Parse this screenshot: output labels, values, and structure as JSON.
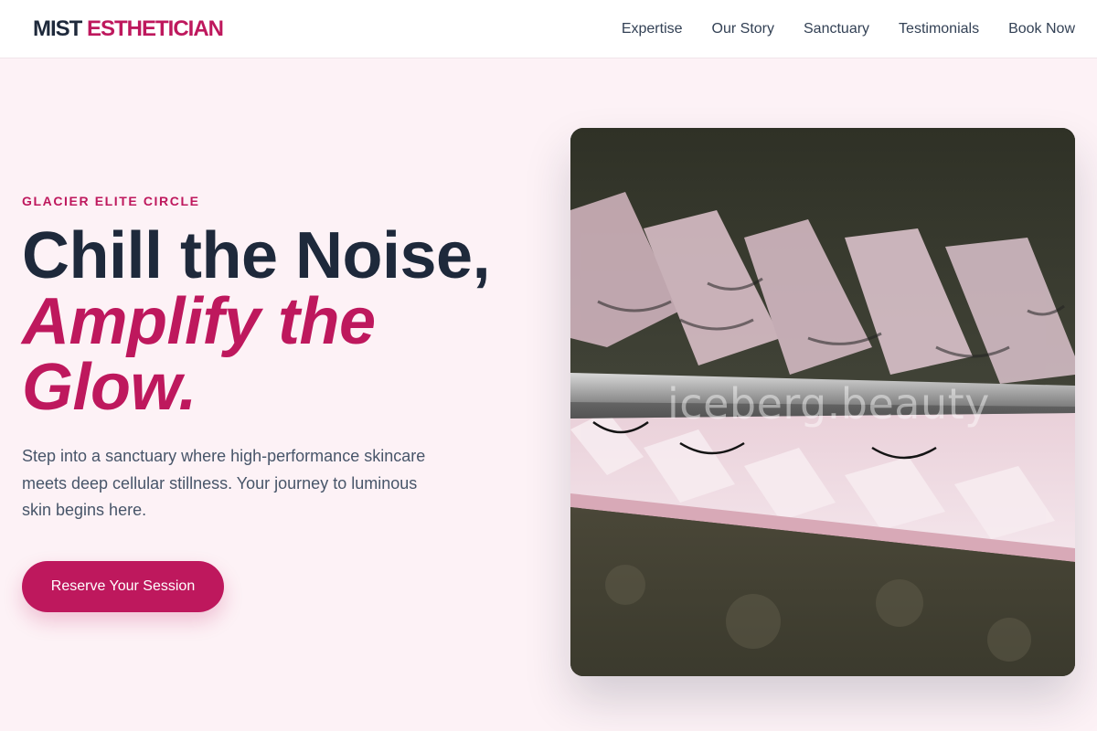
{
  "brand": {
    "name_part1": "MIST",
    "name_part2": "ESTHETICIAN"
  },
  "nav": {
    "items": [
      {
        "label": "Expertise"
      },
      {
        "label": "Our Story"
      },
      {
        "label": "Sanctuary"
      },
      {
        "label": "Testimonials"
      },
      {
        "label": "Book Now"
      }
    ]
  },
  "hero": {
    "eyebrow": "GLACIER ELITE CIRCLE",
    "headline_line1": "Chill the Noise,",
    "headline_line2": "Amplify the",
    "headline_line3": "Glow.",
    "subtext": "Step into a sanctuary where high-performance skincare meets deep cellular stillness. Your journey to luminous skin begins here.",
    "cta_label": "Reserve Your Session",
    "image_watermark": "iceberg.beauty"
  },
  "colors": {
    "accent": "#be185d",
    "heading": "#1e293b",
    "page_background": "#fdf2f6"
  },
  "icons": {
    "hero_image": "eyelash-tray-photo"
  }
}
